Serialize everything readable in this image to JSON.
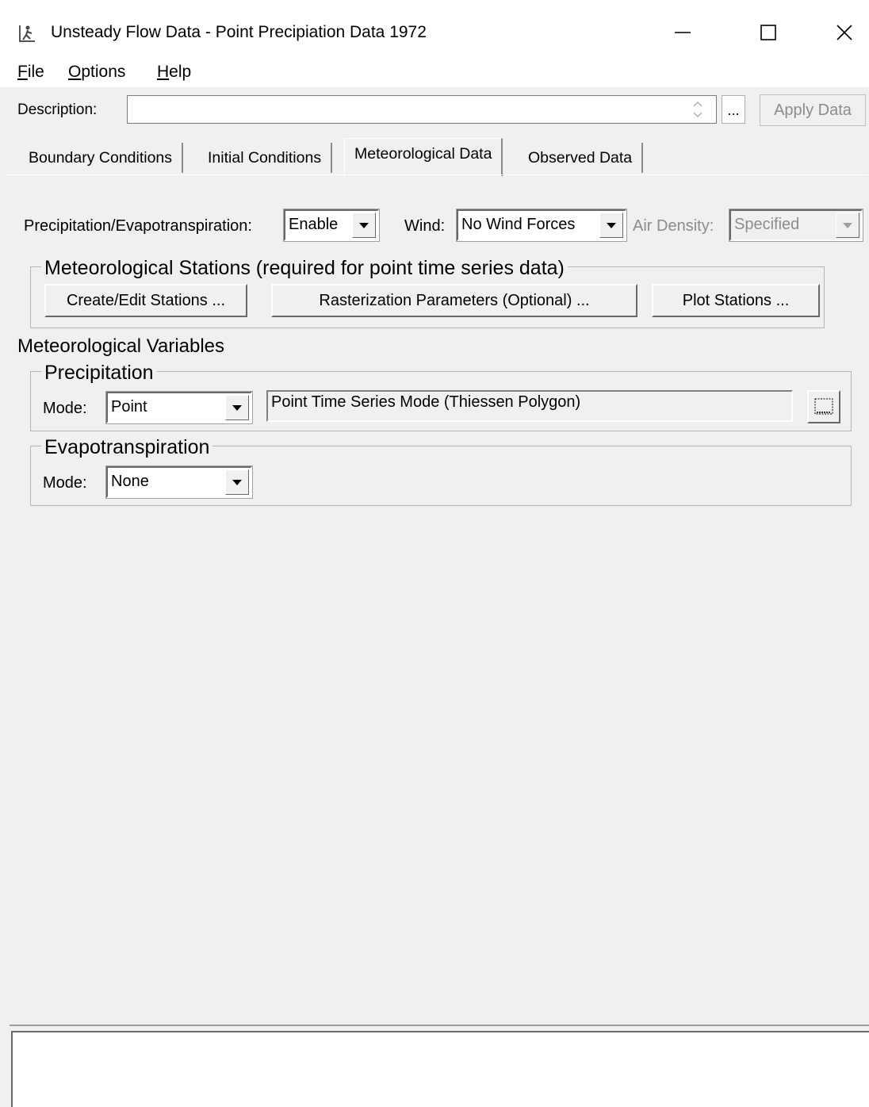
{
  "window": {
    "title": "Unsteady Flow Data - Point Precipiation Data 1972",
    "icons": {
      "app": "hec-ras-person-icon",
      "minimize": "minimize-icon",
      "maximize": "maximize-icon",
      "close": "close-icon"
    }
  },
  "menu": {
    "file": {
      "accel": "F",
      "rest": "ile"
    },
    "options": {
      "accel": "O",
      "rest": "ptions"
    },
    "help": {
      "accel": "H",
      "rest": "elp"
    }
  },
  "description": {
    "label": "Description:",
    "value": "",
    "ellipsis_label": "...",
    "apply_label": "Apply Data"
  },
  "tabs": [
    {
      "label": "Boundary Conditions"
    },
    {
      "label": "Initial Conditions"
    },
    {
      "label": "Meteorological Data",
      "active": true
    },
    {
      "label": "Observed Data"
    }
  ],
  "met": {
    "precip_evap_label": "Precipitation/Evapotranspiration:",
    "precip_evap_value": "Enable",
    "wind_label": "Wind:",
    "wind_value": "No Wind Forces",
    "air_density_label": "Air Density:",
    "air_density_value": "Specified"
  },
  "stations_group": {
    "title": "Meteorological Stations (required for point time series data)",
    "create_edit_label": "Create/Edit Stations ...",
    "rasterization_label": "Rasterization Parameters (Optional) ...",
    "plot_label": "Plot Stations ..."
  },
  "variables": {
    "heading": "Meteorological Variables",
    "precipitation": {
      "title": "Precipitation",
      "mode_label": "Mode:",
      "mode_value": "Point",
      "description": "Point Time Series Mode (Thiessen Polygon)"
    },
    "evapotranspiration": {
      "title": "Evapotranspiration",
      "mode_label": "Mode:",
      "mode_value": "None"
    }
  },
  "status": {
    "text": ""
  }
}
